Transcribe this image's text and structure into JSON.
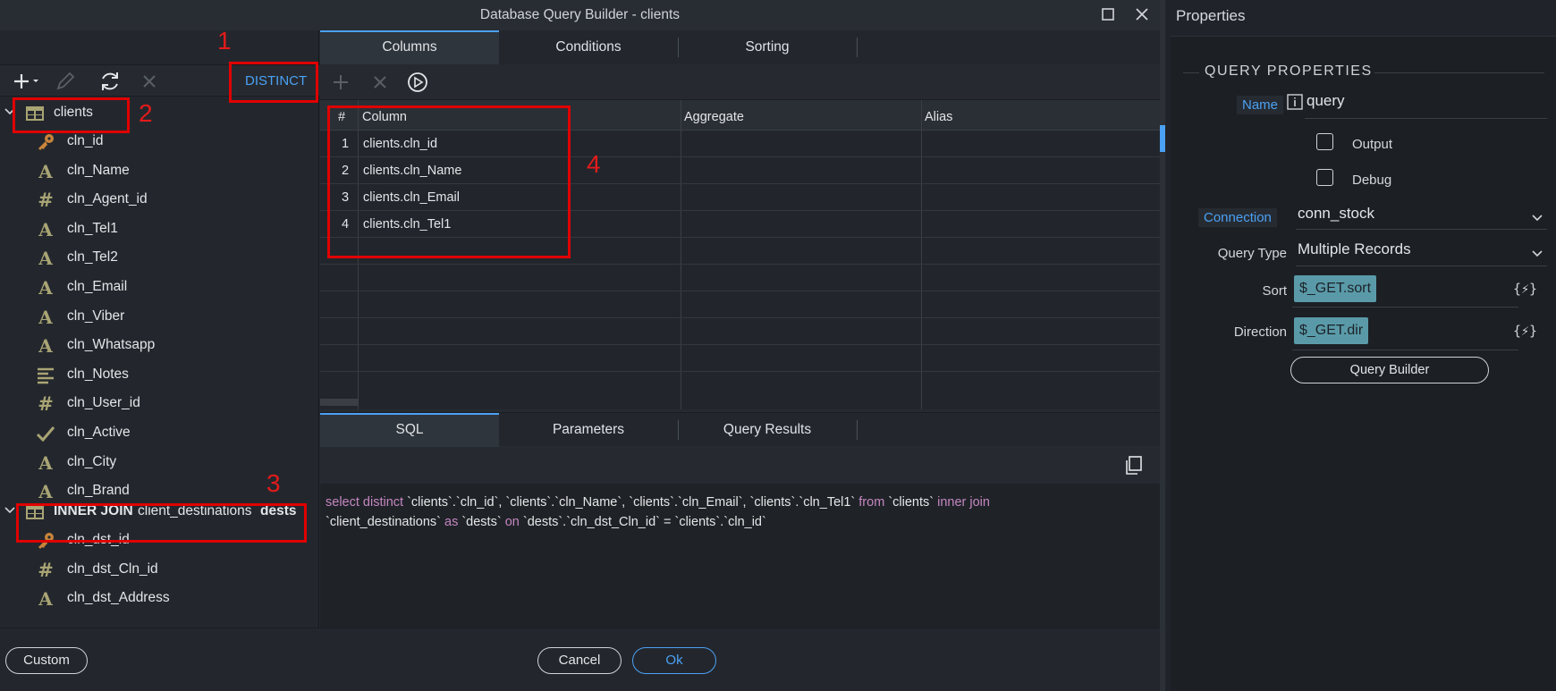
{
  "window": {
    "title": "Database Query Builder - clients"
  },
  "left_toolbar": {
    "distinct_label": "DISTINCT"
  },
  "tree": {
    "table": "clients",
    "fields": [
      {
        "name": "cln_id",
        "icon": "key-icon"
      },
      {
        "name": "cln_Name",
        "icon": "text-field-icon"
      },
      {
        "name": "cln_Agent_id",
        "icon": "number-field-icon"
      },
      {
        "name": "cln_Tel1",
        "icon": "text-field-icon"
      },
      {
        "name": "cln_Tel2",
        "icon": "text-field-icon"
      },
      {
        "name": "cln_Email",
        "icon": "text-field-icon"
      },
      {
        "name": "cln_Viber",
        "icon": "text-field-icon"
      },
      {
        "name": "cln_Whatsapp",
        "icon": "text-field-icon"
      },
      {
        "name": "cln_Notes",
        "icon": "memo-field-icon"
      },
      {
        "name": "cln_User_id",
        "icon": "number-field-icon"
      },
      {
        "name": "cln_Active",
        "icon": "boolean-field-icon"
      },
      {
        "name": "cln_City",
        "icon": "text-field-icon"
      },
      {
        "name": "cln_Brand",
        "icon": "text-field-icon"
      }
    ],
    "join": {
      "type": "INNER JOIN",
      "table": "client_destinations",
      "alias": "dests"
    },
    "join_fields": [
      {
        "name": "cln_dst_id",
        "icon": "key-icon"
      },
      {
        "name": "cln_dst_Cln_id",
        "icon": "number-field-icon"
      },
      {
        "name": "cln_dst_Address",
        "icon": "text-field-icon"
      }
    ]
  },
  "top_tabs": [
    "Columns",
    "Conditions",
    "Sorting"
  ],
  "grid": {
    "headers": [
      "#",
      "Column",
      "Aggregate",
      "Alias"
    ],
    "rows": [
      {
        "num": "1",
        "column": "clients.cln_id"
      },
      {
        "num": "2",
        "column": "clients.cln_Name"
      },
      {
        "num": "3",
        "column": "clients.cln_Email"
      },
      {
        "num": "4",
        "column": "clients.cln_Tel1"
      }
    ]
  },
  "bottom_tabs": [
    "SQL",
    "Parameters",
    "Query Results"
  ],
  "sql": {
    "line1": [
      {
        "t": "select distinct ",
        "kw": true
      },
      {
        "t": "`clients`.`cln_id`, `clients`.`cln_Name`, `clients`.`cln_Email`, `clients`.`cln_Tel1` ",
        "kw": false
      },
      {
        "t": "from ",
        "kw": true
      },
      {
        "t": "`clients` ",
        "kw": false
      },
      {
        "t": "inner join",
        "kw": true
      }
    ],
    "line2": [
      {
        "t": "`client_destinations` ",
        "kw": false
      },
      {
        "t": "as ",
        "kw": true
      },
      {
        "t": "`dests` ",
        "kw": false
      },
      {
        "t": "on ",
        "kw": true
      },
      {
        "t": "`dests`.`cln_dst_Cln_id` = `clients`.`cln_id`",
        "kw": false
      }
    ]
  },
  "footer": {
    "custom_label": "Custom",
    "cancel_label": "Cancel",
    "ok_label": "Ok"
  },
  "annotations": [
    "1",
    "2",
    "3",
    "4"
  ],
  "properties": {
    "panel_title": "Properties",
    "section": "QUERY PROPERTIES",
    "name_label": "Name",
    "name_value": "query",
    "output_label": "Output",
    "debug_label": "Debug",
    "connection_label": "Connection",
    "connection_value": "conn_stock",
    "query_type_label": "Query Type",
    "query_type_value": "Multiple Records",
    "sort_label": "Sort",
    "sort_value": "$_GET.sort",
    "direction_label": "Direction",
    "direction_value": "$_GET.dir",
    "dynamic_symbol": "{⚡}",
    "query_builder_label": "Query Builder"
  },
  "colors": {
    "accent": "#4ba1f4",
    "annotation": "#e00000",
    "keyword": "#c586c0",
    "field_icon": "#a9a474"
  }
}
